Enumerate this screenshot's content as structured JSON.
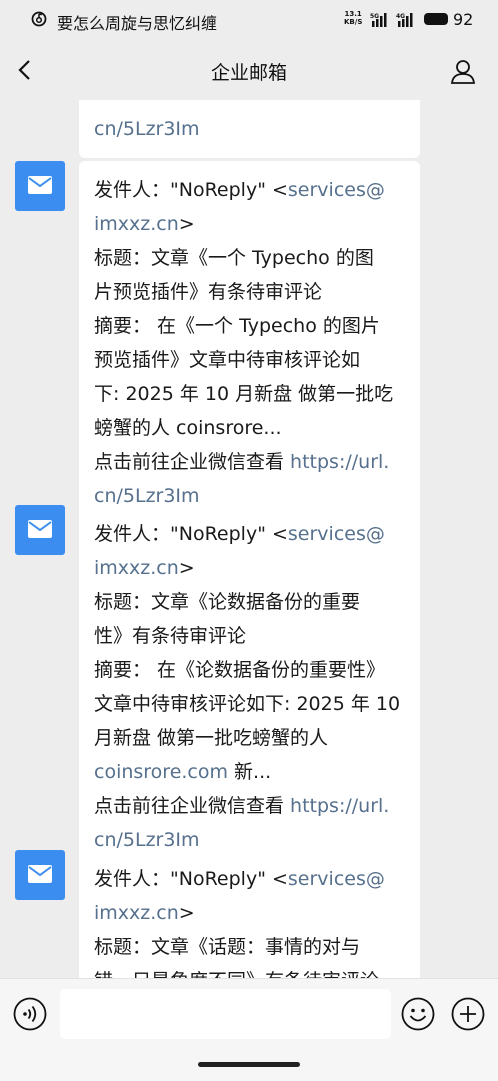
{
  "status_bar": {
    "song_title": "要怎么周旋与思忆纠缠",
    "net_speed_value": "13.1",
    "net_speed_unit": "KB/S",
    "sim1_label": "5G",
    "sim2_label": "4G",
    "battery_level": "92"
  },
  "header": {
    "title": "企业邮箱"
  },
  "messages": [
    {
      "lines": [
        {
          "text": "cn/5Lzr3Im",
          "link": true
        }
      ]
    },
    {
      "lines": [
        {
          "parts": [
            {
              "text": "发件人：\"NoReply\" <",
              "link": false
            },
            {
              "text": "services@",
              "link": true
            }
          ]
        },
        {
          "parts": [
            {
              "text": "imxxz.cn",
              "link": true
            },
            {
              "text": ">",
              "link": false
            }
          ]
        },
        {
          "parts": [
            {
              "text": "标题：文章《一个 Typecho 的图",
              "link": false
            }
          ]
        },
        {
          "parts": [
            {
              "text": "片预览插件》有条待审评论",
              "link": false
            }
          ]
        },
        {
          "parts": [
            {
              "text": "摘要： 在《一个 Typecho 的图片",
              "link": false
            }
          ]
        },
        {
          "parts": [
            {
              "text": "预览插件》文章中待审核评论如",
              "link": false
            }
          ]
        },
        {
          "parts": [
            {
              "text": "下: 2025 年 10 月新盘 做第一批吃",
              "link": false
            }
          ]
        },
        {
          "parts": [
            {
              "text": "螃蟹的人 coinsrore...",
              "link": false
            }
          ]
        },
        {
          "parts": [
            {
              "text": "点击前往企业微信查看 ",
              "link": false
            },
            {
              "text": "https://url.",
              "link": true
            }
          ]
        },
        {
          "parts": [
            {
              "text": "cn/5Lzr3Im",
              "link": true
            }
          ]
        }
      ]
    },
    {
      "lines": [
        {
          "parts": [
            {
              "text": "发件人：\"NoReply\" <",
              "link": false
            },
            {
              "text": "services@",
              "link": true
            }
          ]
        },
        {
          "parts": [
            {
              "text": "imxxz.cn",
              "link": true
            },
            {
              "text": ">",
              "link": false
            }
          ]
        },
        {
          "parts": [
            {
              "text": "标题：文章《论数据备份的重要",
              "link": false
            }
          ]
        },
        {
          "parts": [
            {
              "text": "性》有条待审评论",
              "link": false
            }
          ]
        },
        {
          "parts": [
            {
              "text": "摘要： 在《论数据备份的重要性》",
              "link": false
            }
          ]
        },
        {
          "parts": [
            {
              "text": "文章中待审核评论如下: 2025 年 10",
              "link": false
            }
          ]
        },
        {
          "parts": [
            {
              "text": "月新盘 做第一批吃螃蟹的人",
              "link": false
            }
          ]
        },
        {
          "parts": [
            {
              "text": "coinsrore.com",
              "link": true
            },
            {
              "text": " 新...",
              "link": false
            }
          ]
        },
        {
          "parts": [
            {
              "text": "点击前往企业微信查看 ",
              "link": false
            },
            {
              "text": "https://url.",
              "link": true
            }
          ]
        },
        {
          "parts": [
            {
              "text": "cn/5Lzr3Im",
              "link": true
            }
          ]
        }
      ]
    },
    {
      "lines": [
        {
          "parts": [
            {
              "text": "发件人：\"NoReply\" <",
              "link": false
            },
            {
              "text": "services@",
              "link": true
            }
          ]
        },
        {
          "parts": [
            {
              "text": "imxxz.cn",
              "link": true
            },
            {
              "text": ">",
              "link": false
            }
          ]
        },
        {
          "parts": [
            {
              "text": "标题：文章《话题：事情的对与",
              "link": false
            }
          ]
        },
        {
          "parts": [
            {
              "text": "错，只是角度不同》有条待审评论",
              "link": false
            }
          ]
        }
      ]
    }
  ],
  "composer": {
    "input_value": ""
  },
  "colors": {
    "background": "#ededed",
    "bubble": "#ffffff",
    "link": "#56708d",
    "avatar": "#3b8ef0"
  }
}
